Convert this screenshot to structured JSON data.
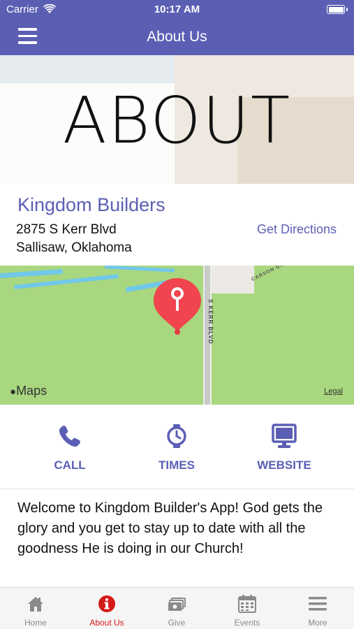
{
  "status_bar": {
    "carrier": "Carrier",
    "time": "10:17 AM"
  },
  "nav": {
    "title": "About Us",
    "menu_icon": "hamburger-menu-icon"
  },
  "hero": {
    "text": "ABOUT"
  },
  "info": {
    "name": "Kingdom Builders",
    "address_line1": "2875 S Kerr Blvd",
    "address_line2": "Sallisaw, Oklahoma",
    "directions_label": "Get Directions"
  },
  "map": {
    "road_label": "S KERR BLVD",
    "street_label": "CARSON DR",
    "attribution": "Maps",
    "legal": "Legal",
    "pin_icon": "map-pin-icon"
  },
  "actions": [
    {
      "label": "CALL",
      "icon": "phone-icon"
    },
    {
      "label": "TIMES",
      "icon": "clock-icon"
    },
    {
      "label": "WEBSITE",
      "icon": "monitor-icon"
    }
  ],
  "welcome": {
    "text": "Welcome to Kingdom Builder's App! God gets the glory and you get to stay up to date with all the goodness He is doing in our Church!"
  },
  "tabs": [
    {
      "label": "Home",
      "icon": "home-icon",
      "active": false
    },
    {
      "label": "About Us",
      "icon": "info-icon",
      "active": true
    },
    {
      "label": "Give",
      "icon": "money-icon",
      "active": false
    },
    {
      "label": "Events",
      "icon": "calendar-icon",
      "active": false
    },
    {
      "label": "More",
      "icon": "more-menu-icon",
      "active": false
    }
  ],
  "colors": {
    "primary": "#5b5fb4",
    "active_tab": "#d41a1a",
    "pin": "#f0444e",
    "map_green": "#a9d77f"
  }
}
